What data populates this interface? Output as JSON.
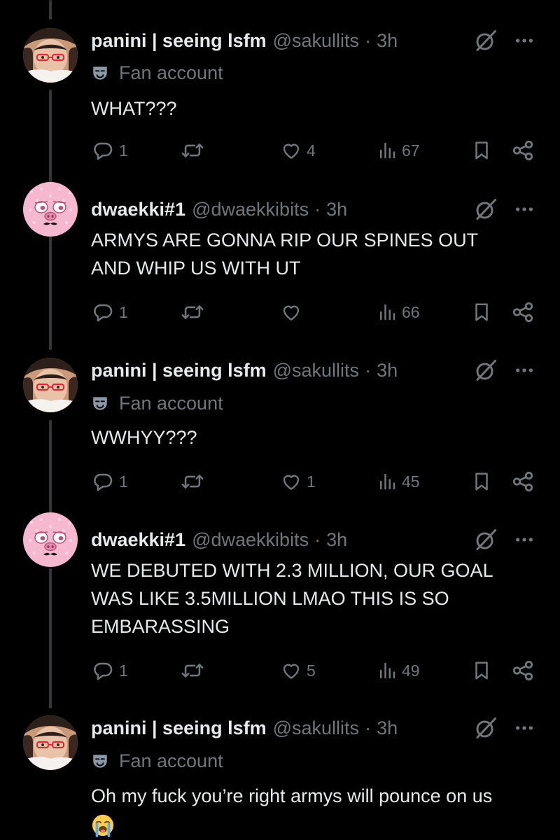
{
  "users": {
    "panini": {
      "display_name": "panini | seeing lsfm",
      "handle": "@sakullits",
      "badge": "Fan account"
    },
    "dwaekki": {
      "display_name": "dwaekki#1",
      "handle": "@dwaekkibits"
    }
  },
  "separator": "·",
  "tweets": [
    {
      "time": "3h",
      "text": "WHAT???",
      "replies": "1",
      "retweets": "",
      "likes": "4",
      "views": "67"
    },
    {
      "time": "3h",
      "text": "ARMYS ARE GONNA RIP OUR SPINES OUT AND WHIP US WITH UT",
      "replies": "1",
      "retweets": "",
      "likes": "",
      "views": "66"
    },
    {
      "time": "3h",
      "text": "WWHYY???",
      "replies": "1",
      "retweets": "",
      "likes": "1",
      "views": "45"
    },
    {
      "time": "3h",
      "text": "WE DEBUTED WITH 2.3 MILLION, OUR GOAL WAS LIKE 3.5MILLION LMAO THIS IS SO EMBARASSING",
      "replies": "1",
      "retweets": "",
      "likes": "5",
      "views": "49"
    },
    {
      "time": "3h",
      "text": "Oh my fuck you’re right armys will pounce on us",
      "emoji": "loudly-crying-face"
    }
  ],
  "icons": {
    "reply": "reply-icon",
    "retweet": "retweet-icon",
    "like": "heart-icon",
    "views": "views-icon",
    "bookmark": "bookmark-icon",
    "share": "share-icon",
    "grok": "grok-icon",
    "more": "more-icon",
    "badge": "fan-account-mask-icon"
  },
  "colors": {
    "background": "#000000",
    "text": "#e7e9ea",
    "muted": "#71767b",
    "thread_line": "#333639"
  }
}
